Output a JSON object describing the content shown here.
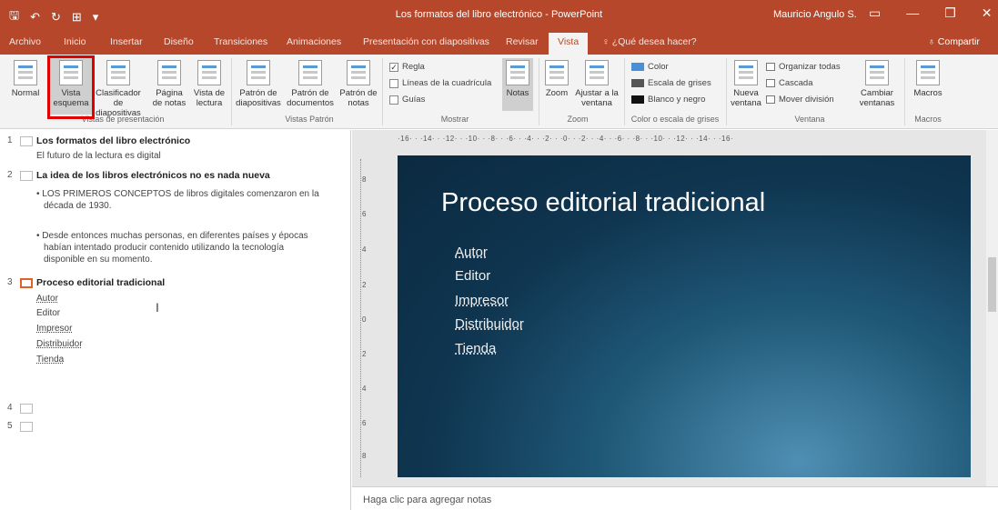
{
  "titlebar": {
    "title": "Los formatos del libro electrónico - PowerPoint",
    "user": "Mauricio Angulo S.",
    "qat": [
      "🖫",
      "↶",
      "↻",
      "⊞",
      "▾"
    ],
    "win": [
      "▭",
      "—",
      "❐",
      "✕"
    ]
  },
  "tabs": [
    "Archivo",
    "Inicio",
    "Insertar",
    "Diseño",
    "Transiciones",
    "Animaciones",
    "Presentación con diapositivas",
    "Revisar",
    "Vista"
  ],
  "tellme": "♀ ¿Qué desea hacer?",
  "share": "♁ Compartir",
  "ribbon": {
    "presentation_views": {
      "label": "Vistas de presentación",
      "buttons": [
        "Normal",
        "Vista esquema",
        "Clasificador de diapositivas",
        "Página de notas",
        "Vista de lectura"
      ]
    },
    "master_views": {
      "label": "Vistas Patrón",
      "buttons": [
        "Patrón de diapositivas",
        "Patrón de documentos",
        "Patrón de notas"
      ]
    },
    "show": {
      "label": "Mostrar",
      "checks": [
        {
          "label": "Regla",
          "checked": true
        },
        {
          "label": "Líneas de la cuadrícula",
          "checked": false
        },
        {
          "label": "Guías",
          "checked": false
        }
      ],
      "notes": "Notas"
    },
    "zoom": {
      "label": "Zoom",
      "buttons": [
        "Zoom",
        "Ajustar a la ventana"
      ]
    },
    "color": {
      "label": "Color o escala de grises",
      "options": [
        {
          "label": "Color",
          "color": "#4a90d9"
        },
        {
          "label": "Escala de grises",
          "color": "#555555"
        },
        {
          "label": "Blanco y negro",
          "color": "#111111"
        }
      ]
    },
    "window": {
      "label": "Ventana",
      "new": "Nueva ventana",
      "options": [
        "Organizar todas",
        "Cascada",
        "Mover división"
      ],
      "switch": "Cambiar ventanas"
    },
    "macros": {
      "label": "Macros",
      "button": "Macros"
    }
  },
  "outline": {
    "slides": [
      {
        "num": "1",
        "title": "Los formatos del libro electrónico",
        "lines": [
          "El futuro de la lectura es digital"
        ]
      },
      {
        "num": "2",
        "title": "La idea de los libros electrónicos no es nada nueva",
        "lines": [
          "• LOS PRIMEROS CONCEPTOS de libros digitales comenzaron en la",
          "década de 1930.",
          "• Desde entonces muchas personas, en diferentes países y épocas",
          "habían intentado producir contenido utilizando la tecnología",
          "disponible en su momento."
        ]
      },
      {
        "num": "3",
        "title": "Proceso editorial tradicional",
        "lines": [
          "Autor",
          "Editor",
          "Impresor",
          "Distribuidor",
          "Tienda"
        ]
      },
      {
        "num": "4",
        "title": "",
        "lines": []
      },
      {
        "num": "5",
        "title": "",
        "lines": []
      }
    ]
  },
  "hruler": "·16·  ·  ·14·  ·  ·12·  ·  ·10·  ·  ·8·  ·  ·6·  ·  ·4·  ·  ·2·  ·  ·0·  ·  ·2·  ·  ·4·  ·  ·6·  ·  ·8·  ·  ·10·  ·  ·12·  ·  ·14·  ·  ·16·",
  "vruler": [
    "8",
    "6",
    "4",
    "2",
    "0",
    "2",
    "4",
    "6",
    "8"
  ],
  "slide": {
    "title": "Proceso editorial tradicional",
    "bullets": [
      "Autor",
      "Editor",
      "Impresor",
      "Distribuidor",
      "Tienda"
    ]
  },
  "notes_placeholder": "Haga clic para agregar notas"
}
